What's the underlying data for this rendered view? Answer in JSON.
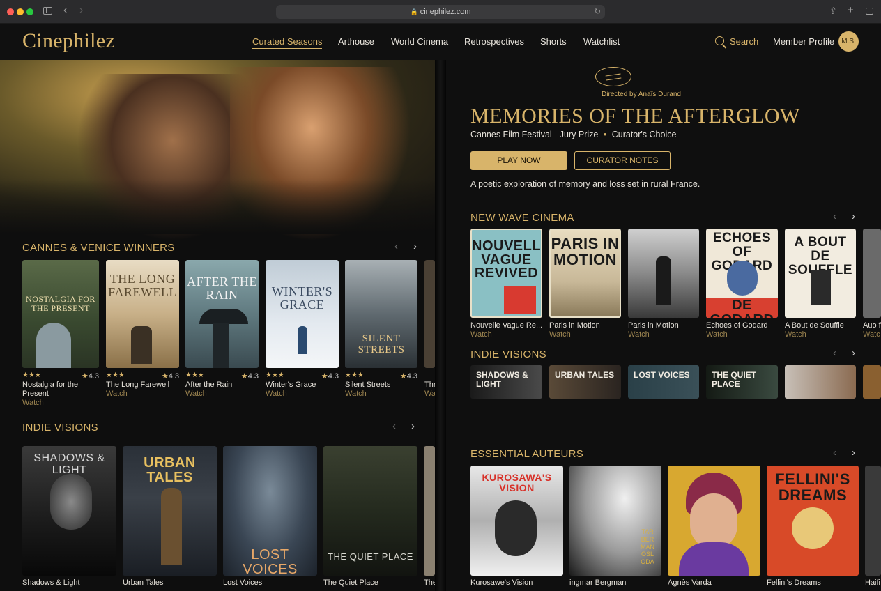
{
  "browser": {
    "url": "cinephilez.com"
  },
  "header": {
    "logo": "Cinephilez",
    "nav": [
      "Curated Seasons",
      "Arthouse",
      "World Cinema",
      "Retrospectives",
      "Shorts",
      "Watchlist"
    ],
    "search_label": "Search",
    "member_label": "Member Profile",
    "avatar_initials": "M.S."
  },
  "left": {
    "cannes": {
      "title": "CANNES & VENICE WINNERS",
      "films": [
        {
          "poster_title": "NOSTALGIA FOR THE PRESENT",
          "name": "Nostalgia for the",
          "name2": "Present",
          "stars": "★★★",
          "rating": "4.3",
          "watch": "Watch"
        },
        {
          "poster_title": "THE LONG FAREWELL",
          "name": "The Long Farewell",
          "stars": "★★★",
          "rating": "4.3",
          "watch": "Watch"
        },
        {
          "poster_title": "AFTER THE RAIN",
          "name": "After the Rain",
          "stars": "★★★",
          "rating": "4.3",
          "watch": "Watch"
        },
        {
          "poster_title": "WINTER'S GRACE",
          "name": "Winter's Grace",
          "stars": "★★★",
          "rating": "4.3",
          "watch": "Watch"
        },
        {
          "poster_title": "SILENT STREETS",
          "name": "Silent Streets",
          "stars": "★★★",
          "rating": "4.3",
          "watch": "Watch"
        },
        {
          "name": "Thr",
          "watch": "Wa"
        }
      ]
    },
    "indie": {
      "title": "INDIE VISIONS",
      "films": [
        {
          "poster_title": "SHADOWS & LIGHT",
          "name": "Shadows & Light"
        },
        {
          "poster_title": "URBAN TALES",
          "name": "Urban Tales"
        },
        {
          "poster_title": "LOST VOICES",
          "name": "Lost Voices"
        },
        {
          "poster_title": "THE QUIET PLACE",
          "name": "The Quiet Place"
        },
        {
          "name": "The"
        }
      ]
    }
  },
  "right": {
    "feature": {
      "directed": "Directed by Anaïs Durand",
      "title": "MEMORIES OF THE AFTERGLOW",
      "award": "Cannes Film Festival - Jury Prize",
      "badge": "Curator's Choice",
      "play": "PLAY NOW",
      "notes": "CURATOR NOTES",
      "description": "A poetic exploration of memory and loss set in rural France."
    },
    "newwave": {
      "title": "NEW WAVE CINEMA",
      "films": [
        {
          "poster_title": "NOUVELLE VAGUE REVIVED",
          "name": "Nouvelle Vague Re...",
          "watch": "Watch"
        },
        {
          "poster_title": "PARIS IN MOTION",
          "name": "Paris in Motion",
          "watch": "Watch"
        },
        {
          "poster_title": "",
          "name": "Paris in Motion",
          "watch": "Watch"
        },
        {
          "poster_title": "ECHOES OF GODARD",
          "poster_sub": "DE GODARD",
          "name": "Echoes of Godard",
          "watch": "Watch"
        },
        {
          "poster_title": "A BOUT DE SOUFFLE",
          "name": "A Bout de Souffle",
          "watch": "Watch"
        },
        {
          "name": "Auo f",
          "watch": "Watc"
        }
      ]
    },
    "indie": {
      "title": "INDIE VISIONS",
      "films": [
        {
          "poster_title": "SHADOWS & LIGHT"
        },
        {
          "poster_title": "URBAN TALES"
        },
        {
          "poster_title": "LOST VOICES"
        },
        {
          "poster_title": "THE QUIET PLACE"
        },
        {
          "poster_title": ""
        }
      ]
    },
    "auteurs": {
      "title": "ESSENTIAL AUTEURS",
      "films": [
        {
          "poster_title": "KUROSAWA'S VISION",
          "name": "Kurosawe's Vision"
        },
        {
          "poster_title": "TAR BER MAN OSL ODA",
          "name": "ingmar Bergman"
        },
        {
          "poster_title": "",
          "name": "Agnès Varda"
        },
        {
          "poster_title": "FELLINI'S DREAMS",
          "name": "Fellini's Dreams"
        },
        {
          "name": "Haifi"
        }
      ]
    }
  },
  "colors": {
    "accent": "#d8b46a",
    "background": "#0e0e0e",
    "watch": "#9c8450"
  },
  "icons": [
    "sidebar-icon",
    "back-icon",
    "forward-icon",
    "lock-icon",
    "reload-icon",
    "share-icon",
    "new-tab-icon",
    "tabs-icon",
    "search-icon",
    "palme-icon",
    "chevron-left-icon",
    "chevron-right-icon"
  ]
}
